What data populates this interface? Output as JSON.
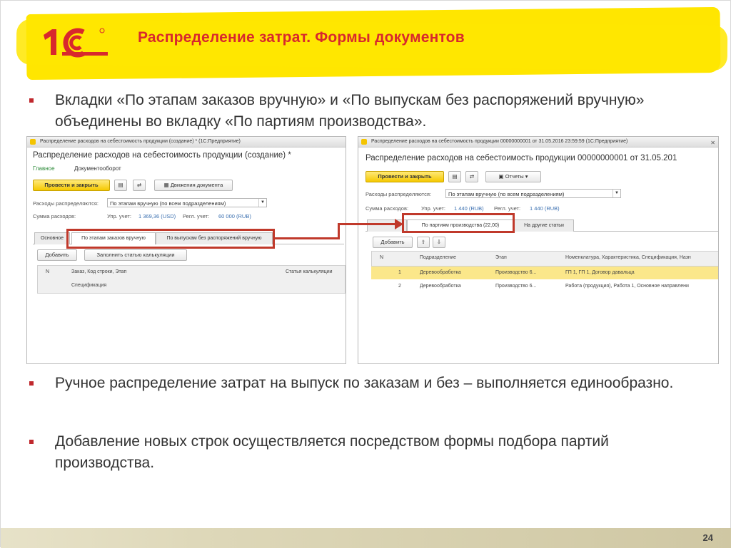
{
  "slide": {
    "title": "Распределение затрат. Формы документов",
    "page_number": "24",
    "logo_text": "1С",
    "bullets": [
      "Вкладки «По этапам заказов вручную» и «По выпускам без распоряжений вручную» объединены во вкладку «По партиям производства».",
      "Ручное распределение затрат на выпуск по заказам и без – выполняется единообразно.",
      "Добавление новых строк осуществляется посредством формы подбора партий производства."
    ]
  },
  "left_window": {
    "window_title": "Распределение расходов на себестоимость продукции (создание) * (1С:Предприятие)",
    "form_title": "Распределение расходов на себестоимость продукции (создание) *",
    "nav_links": [
      "Главное",
      "Документооборот"
    ],
    "toolbar": {
      "post_close": "Провести и закрыть",
      "movements": "Движения документа"
    },
    "distribution_label": "Расходы распределяются:",
    "distribution_value": "По этапам вручную (по всем подразделениям)",
    "sum_label": "Сумма расходов:",
    "mgmt_label": "Упр. учет:",
    "mgmt_value": "1 369,36 (USD)",
    "reg_label": "Регл. учет:",
    "reg_value": "60 000 (RUB)",
    "tabs": [
      "Основное",
      "По этапам заказов вручную",
      "По выпускам без распоряжений вручную"
    ],
    "table_buttons": [
      "Добавить",
      "Заполнить статью калькуляции"
    ],
    "columns": [
      "N",
      "Заказ, Код строки, Этап",
      "Статья калькуляции",
      "Спецификация"
    ]
  },
  "right_window": {
    "window_title": "Распределение расходов на себестоимость продукции 00000000001 от 31.05.2016 23:59:59 (1С:Предприятие)",
    "form_title": "Распределение расходов на себестоимость продукции 00000000001 от 31.05.201",
    "toolbar": {
      "post_close": "Провести и закрыть",
      "reports": "Отчеты"
    },
    "distribution_label": "Расходы распределяются:",
    "distribution_value": "По этапам вручную (по всем подразделениям)",
    "sum_label": "Сумма расходов:",
    "mgmt_label": "Упр. учет:",
    "mgmt_value": "1 440 (RUB)",
    "reg_label": "Регл. учет:",
    "reg_value": "1 440 (RUB)",
    "tabs": [
      "По партиям производства (22,00)",
      "На другие статьи"
    ],
    "table_buttons": [
      "Добавить"
    ],
    "columns": [
      "N",
      "Подразделение",
      "Этап",
      "Номенклатура, Характеристика, Спецификация, Назн"
    ],
    "rows": [
      {
        "n": "1",
        "division": "Деревообработка",
        "stage": "Производство 6...",
        "item": "ГП 1, ГП 1, Договор давальца"
      },
      {
        "n": "2",
        "division": "Деревообработка",
        "stage": "Производство 6...",
        "item": "Работа (продукция), Работа 1, Основное направлени"
      }
    ]
  },
  "colors": {
    "title_red": "#d8282d",
    "highlight_yellow": "#ffe600",
    "frame_red": "#c0392b",
    "link_green": "#2e8b3a"
  }
}
